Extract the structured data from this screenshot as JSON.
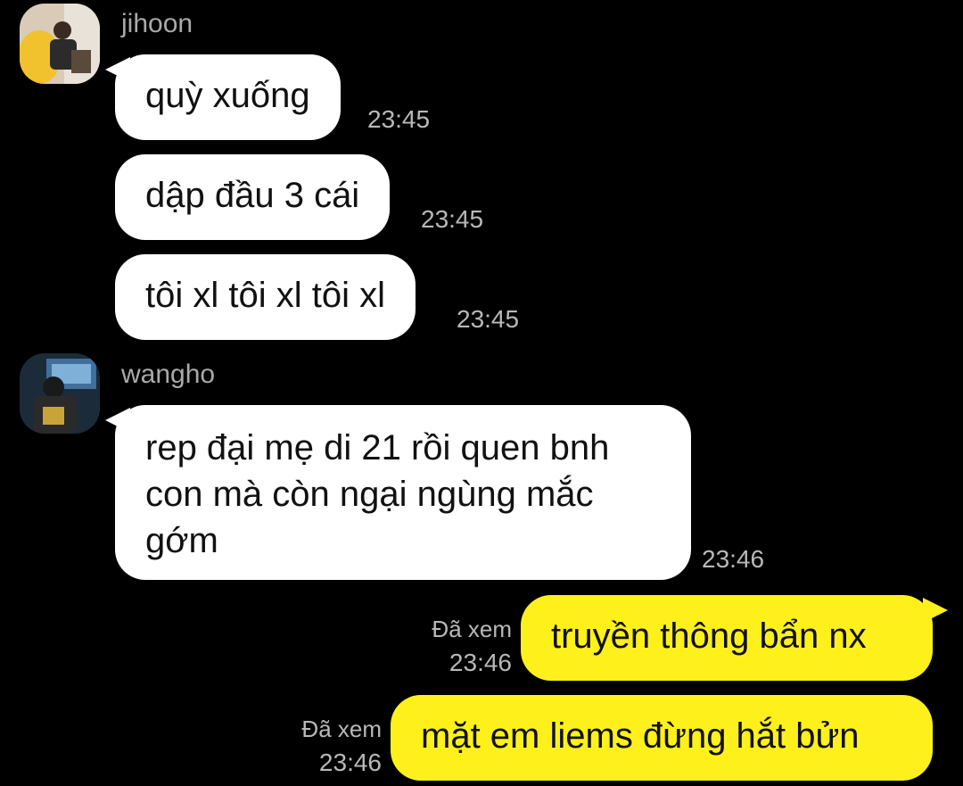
{
  "conversation": {
    "groups": [
      {
        "sender": "jihoon",
        "messages": [
          {
            "text": "quỳ xuống",
            "time": "23:45"
          },
          {
            "text": "dập đầu 3 cái",
            "time": "23:45"
          },
          {
            "text": "tôi xl tôi xl tôi xl",
            "time": "23:45"
          }
        ]
      },
      {
        "sender": "wangho",
        "messages": [
          {
            "text": "rep đại mẹ di 21 rồi quen bnh con mà còn ngại ngùng mắc gớm",
            "time": "23:46"
          }
        ]
      }
    ],
    "outgoing": [
      {
        "read_label": "Đã xem",
        "time": "23:46",
        "text": "truyền thông bẩn nx"
      },
      {
        "read_label": "Đã xem",
        "time": "23:46",
        "text": "mặt em liems đừng hắt bửn"
      }
    ]
  },
  "colors": {
    "background": "#000000",
    "incoming_bubble": "#ffffff",
    "outgoing_bubble": "#fef01b",
    "meta_text": "#b8b8b8"
  },
  "icons": {
    "avatar_jihoon": "avatar-photo",
    "avatar_wangho": "avatar-photo"
  }
}
